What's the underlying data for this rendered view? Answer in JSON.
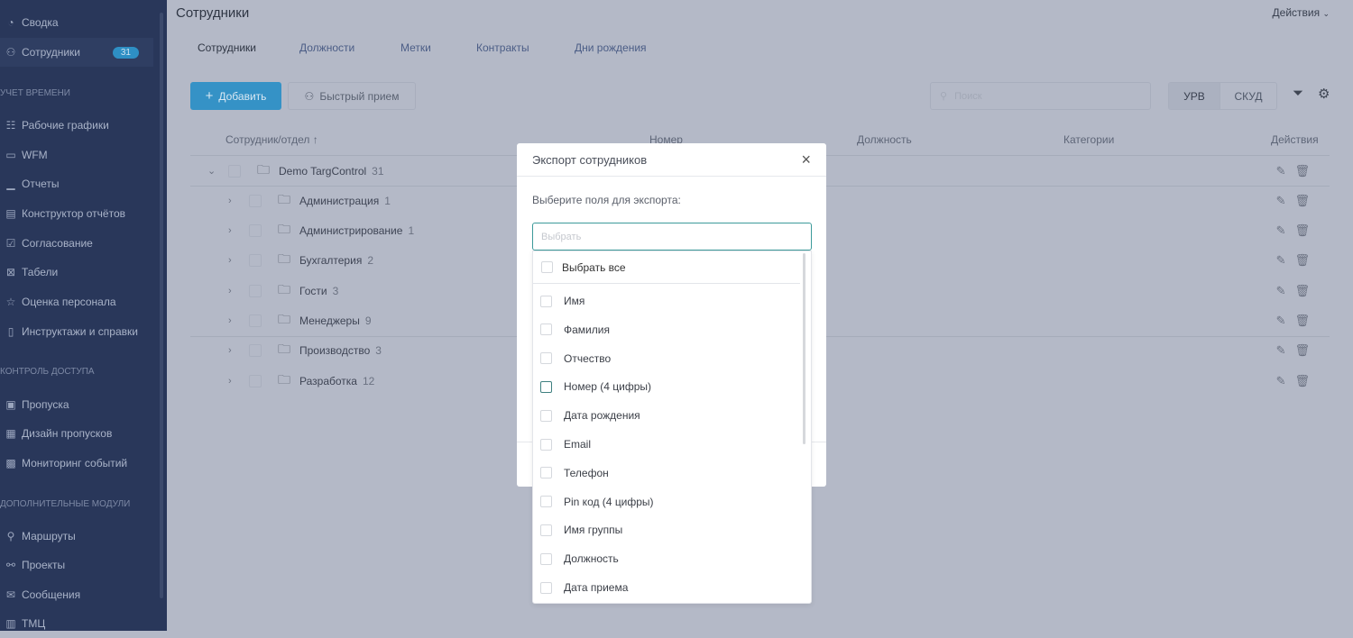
{
  "sidebar": {
    "items": [
      {
        "label": "Сводка",
        "icon": "dashboard-icon"
      },
      {
        "label": "Сотрудники",
        "icon": "users-icon",
        "badge": "31",
        "active": true
      },
      {
        "label": "Рабочие графики",
        "icon": "schedule-icon"
      },
      {
        "label": "WFM",
        "icon": "calendar-icon"
      },
      {
        "label": "Отчеты",
        "icon": "chart-icon"
      },
      {
        "label": "Конструктор отчётов",
        "icon": "report-builder-icon"
      },
      {
        "label": "Согласование",
        "icon": "approval-icon"
      },
      {
        "label": "Табели",
        "icon": "timesheet-icon"
      },
      {
        "label": "Оценка персонала",
        "icon": "star-icon"
      },
      {
        "label": "Инструктажи и справки",
        "icon": "document-icon"
      },
      {
        "label": "Пропуска",
        "icon": "badge-icon"
      },
      {
        "label": "Дизайн пропусков",
        "icon": "badge-design-icon"
      },
      {
        "label": "Мониторинг событий",
        "icon": "monitoring-icon"
      },
      {
        "label": "Маршруты",
        "icon": "route-icon"
      },
      {
        "label": "Проекты",
        "icon": "project-icon"
      },
      {
        "label": "Сообщения",
        "icon": "message-icon"
      },
      {
        "label": "ТМЦ",
        "icon": "inventory-icon"
      }
    ],
    "sections": [
      "Учет времени",
      "Контроль доступа",
      "Дополнительные модули"
    ]
  },
  "header": {
    "title": "Сотрудники",
    "actions": "Действия"
  },
  "tabs": [
    "Сотрудники",
    "Должности",
    "Метки",
    "Контракты",
    "Дни рождения"
  ],
  "toolbar": {
    "add": "Добавить",
    "quick": "Быстрый прием",
    "search_placeholder": "Поиск",
    "seg": [
      "УРВ",
      "СКУД"
    ]
  },
  "table": {
    "headers": [
      "Сотрудник/отдел ↑",
      "Номер",
      "Должность",
      "Категории",
      "Действия"
    ],
    "rows": [
      {
        "name": "Demo TargControl",
        "count": "31"
      },
      {
        "name": "Администрация",
        "count": "1"
      },
      {
        "name": "Администрирование",
        "count": "1"
      },
      {
        "name": "Бухгалтерия",
        "count": "2"
      },
      {
        "name": "Гости",
        "count": "3"
      },
      {
        "name": "Менеджеры",
        "count": "9"
      },
      {
        "name": "Производство",
        "count": "3"
      },
      {
        "name": "Разработка",
        "count": "12"
      }
    ]
  },
  "modal": {
    "title": "Экспорт сотрудников",
    "label": "Выберите поля для экспорта:",
    "placeholder": "Выбрать",
    "select_all": "Выбрать все",
    "options": [
      "Имя",
      "Фамилия",
      "Отчество",
      "Номер (4 цифры)",
      "Дата рождения",
      "Email",
      "Телефон",
      "Pin код (4 цифры)",
      "Имя группы",
      "Должность",
      "Дата приема"
    ]
  },
  "colors": {
    "sidebar": "#29375a",
    "accent": "#3592c6",
    "focus": "#3c9a9a"
  }
}
